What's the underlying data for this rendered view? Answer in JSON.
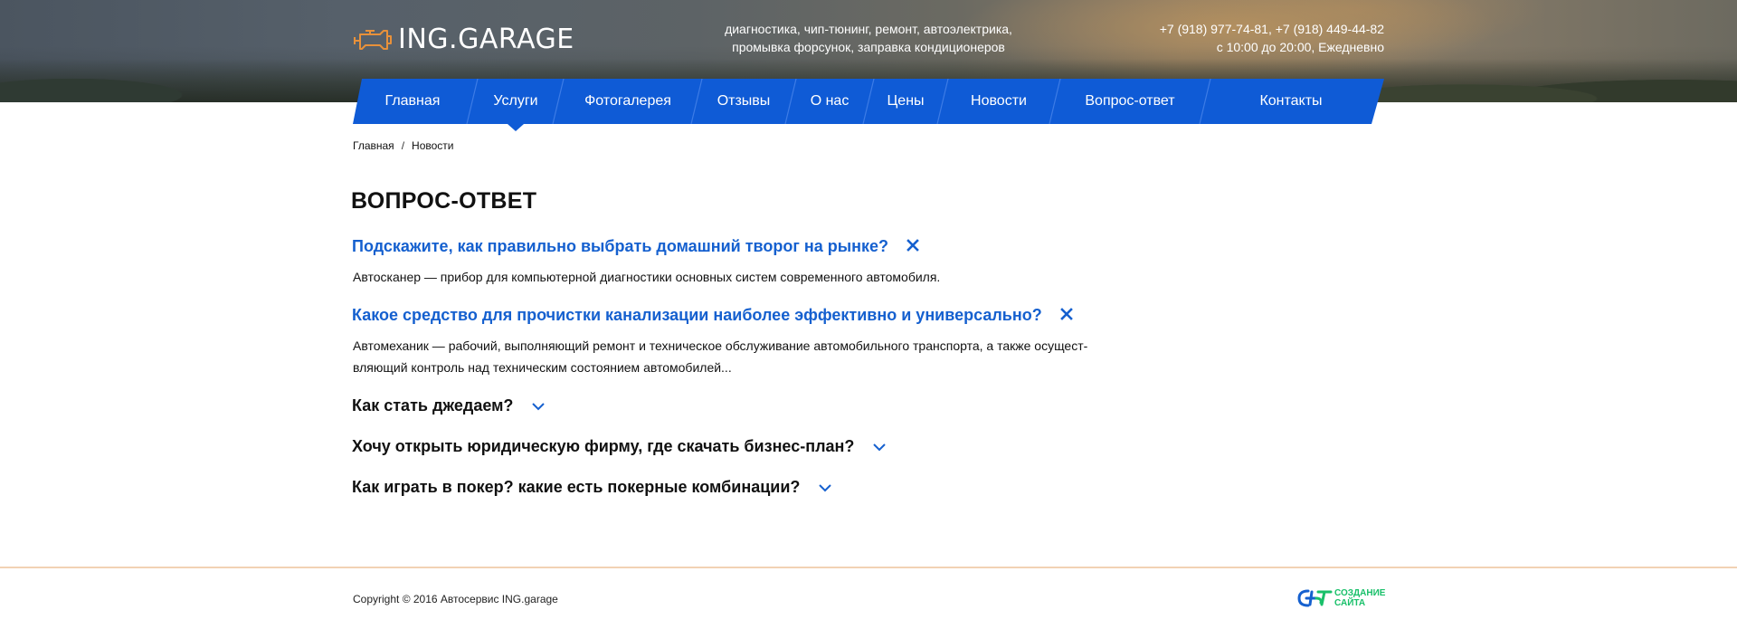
{
  "header": {
    "logo_text": "ING.GARAGE",
    "tagline_line1": "диагностика, чип-тюнинг, ремонт, автоэлектрика,",
    "tagline_line2": "промывка форсунок, заправка кондиционеров",
    "phones": "+7 (918) 977-74-81,  +7 (918) 449-44-82",
    "hours": "с 10:00 до 20:00, Ежедневно"
  },
  "nav": {
    "items": [
      {
        "label": "Главная"
      },
      {
        "label": "Услуги"
      },
      {
        "label": "Фотогалерея"
      },
      {
        "label": "Отзывы"
      },
      {
        "label": "О нас"
      },
      {
        "label": "Цены"
      },
      {
        "label": "Новости"
      },
      {
        "label": "Вопрос-ответ"
      },
      {
        "label": "Контакты"
      }
    ],
    "active_item": "Услуги"
  },
  "breadcrumb": {
    "home": "Главная",
    "separator": "/",
    "current": "Новости"
  },
  "page_title": "ВОПРОС-ОТВЕТ",
  "faq": [
    {
      "question": "Подскажите, как правильно выбрать домашний творог на рынке?",
      "answer_line1": "Автосканер — прибор для компьютерной диагностики основных систем современного автомобиля.",
      "expanded": true
    },
    {
      "question": "Какое средство для прочистки канализации наиболее эффективно и универсально?",
      "answer_line1": "Автомеханик — рабочий, выполняющий ремонт и техническое обслуживание автомобильного транспорта, а также осущест-",
      "answer_line2": "вляющий контроль над техническим состоянием автомобилей...",
      "expanded": true
    },
    {
      "question": "Как стать джедаем?",
      "expanded": false
    },
    {
      "question": "Хочу открыть юридическую фирму, где скачать бизнес-план?",
      "expanded": false
    },
    {
      "question": "Как играть в покер? какие есть покерные комбинации?",
      "expanded": false
    }
  ],
  "footer": {
    "copyright": "Copyright © 2016 Автосервис ING.garage",
    "dev_line1": "СОЗДАНИЕ",
    "dev_line2": "САЙТА"
  },
  "icons": {
    "logo": "engine-icon",
    "open_toggle": "close-x-icon",
    "closed_toggle": "chevron-down-icon",
    "developer": "developer-logo-icon"
  },
  "colors": {
    "nav_blue": "#0f5bd6",
    "link_blue": "#1560cf",
    "logo_orange": "#e8913a",
    "dev_green": "#19c06a",
    "footer_line": "#f2d2b4"
  }
}
